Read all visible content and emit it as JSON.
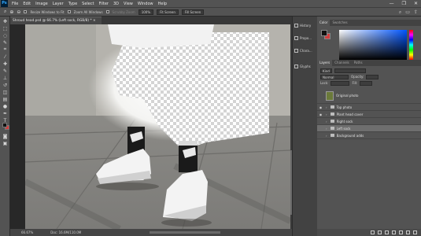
{
  "app": {
    "logo": "Ps"
  },
  "menu": [
    "File",
    "Edit",
    "Image",
    "Layer",
    "Type",
    "Select",
    "Filter",
    "3D",
    "View",
    "Window",
    "Help"
  ],
  "window_controls": [
    "—",
    "❐",
    "✕"
  ],
  "options_bar": {
    "resize_windows": "Resize Windows to Fit",
    "zoom_all": "Zoom All Windows",
    "scrubby_zoom": "Scrubby Zoom",
    "zoom_100": "100%",
    "fit_screen": "Fit Screen",
    "fill_screen": "Fill Screen"
  },
  "document": {
    "tab_title": "Shroud head.psd @ 66.7% (Left sock, RGB/8) * ×",
    "status_zoom": "66.67%",
    "status_doc": "Doc: 16.6M/110.0M"
  },
  "dock_panels": [
    {
      "label": "History",
      "icon": "history-icon"
    },
    {
      "label": "Propo...",
      "icon": "properties-icon"
    },
    {
      "label": "Chara...",
      "icon": "character-icon"
    },
    {
      "label": "Glyphs",
      "icon": "glyphs-icon"
    }
  ],
  "color_panel": {
    "tabs": [
      "Color",
      "Swatches"
    ],
    "foreground": "#111111",
    "background": "#d23d3d"
  },
  "layers_panel": {
    "tabs": [
      "Layers",
      "Channels",
      "Paths"
    ],
    "kind_filter": "Kind",
    "blend_mode": "Normal",
    "opacity_label": "Opacity:",
    "lock_label": "Lock:",
    "fill_label": "Fill:",
    "layers": [
      {
        "name": "Original photo",
        "type": "image",
        "visible": false,
        "selected": false
      },
      {
        "name": "Top photo",
        "type": "group",
        "visible": true,
        "selected": false
      },
      {
        "name": "Plant head cover",
        "type": "group",
        "visible": true,
        "selected": false
      },
      {
        "name": "Right sock",
        "type": "group",
        "visible": false,
        "selected": false
      },
      {
        "name": "Left sock",
        "type": "group",
        "visible": false,
        "selected": true
      },
      {
        "name": "Background adds",
        "type": "group",
        "visible": false,
        "selected": false
      }
    ]
  }
}
